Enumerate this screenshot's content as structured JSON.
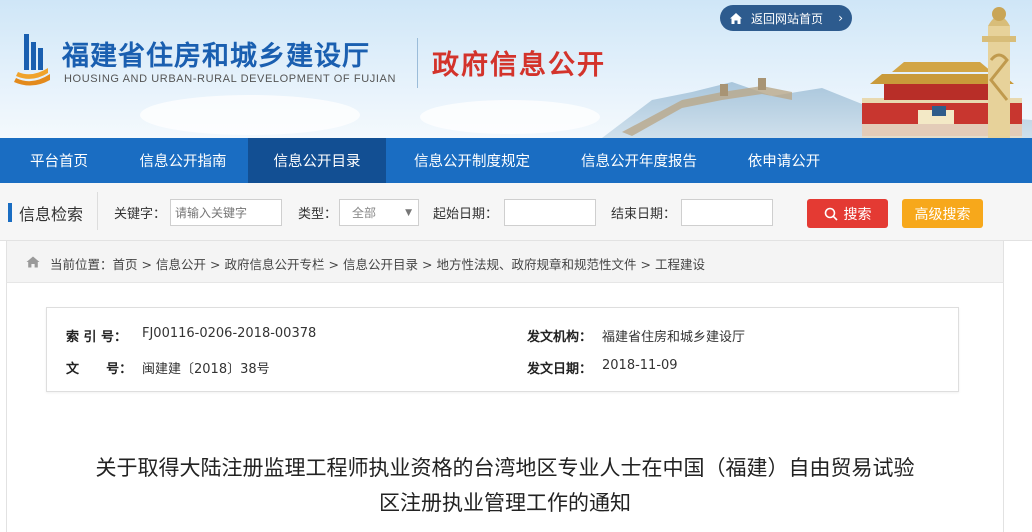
{
  "header": {
    "title_cn": "福建省住房和城乡建设厅",
    "title_en": "HOUSING AND URBAN-RURAL DEVELOPMENT OF FUJIAN",
    "section_title": "政府信息公开",
    "back_home": "返回网站首页"
  },
  "nav": {
    "items": [
      {
        "label": "平台首页"
      },
      {
        "label": "信息公开指南"
      },
      {
        "label": "信息公开目录",
        "active": true
      },
      {
        "label": "信息公开制度规定"
      },
      {
        "label": "信息公开年度报告"
      },
      {
        "label": "依申请公开"
      }
    ]
  },
  "search": {
    "section_title": "信息检索",
    "keyword_label": "关键字：",
    "keyword_placeholder": "请输入关键字",
    "type_label": "类型：",
    "type_value": "全部",
    "start_date_label": "起始日期：",
    "end_date_label": "结束日期：",
    "search_button": "搜索",
    "advanced_button": "高级搜索"
  },
  "breadcrumb": {
    "prefix": "当前位置：",
    "items": [
      "首页",
      "信息公开",
      "政府信息公开专栏",
      "信息公开目录",
      "地方性法规、政府规章和规范性文件",
      "工程建设"
    ],
    "separator": ">"
  },
  "meta": {
    "index_label": "索 引 号：",
    "index_value": "FJ00116-0206-2018-00378",
    "issuer_label": "发文机构：",
    "issuer_value": "福建省住房和城乡建设厅",
    "doc_no_label": "文      号：",
    "doc_no_value": "闽建建〔2018〕38号",
    "date_label": "发文日期：",
    "date_value": "2018-11-09"
  },
  "document": {
    "title_line1": "关于取得大陆注册监理工程师执业资格的台湾地区专业人士在中国（福建）自由贸易试验",
    "title_line2": "区注册执业管理工作的通知"
  },
  "colors": {
    "nav_bg": "#1a6dc2",
    "nav_active": "#124f93",
    "title_blue": "#1a5fb0",
    "section_red": "#d3332b",
    "search_red": "#e43a33",
    "advanced_orange": "#f7a81b"
  }
}
